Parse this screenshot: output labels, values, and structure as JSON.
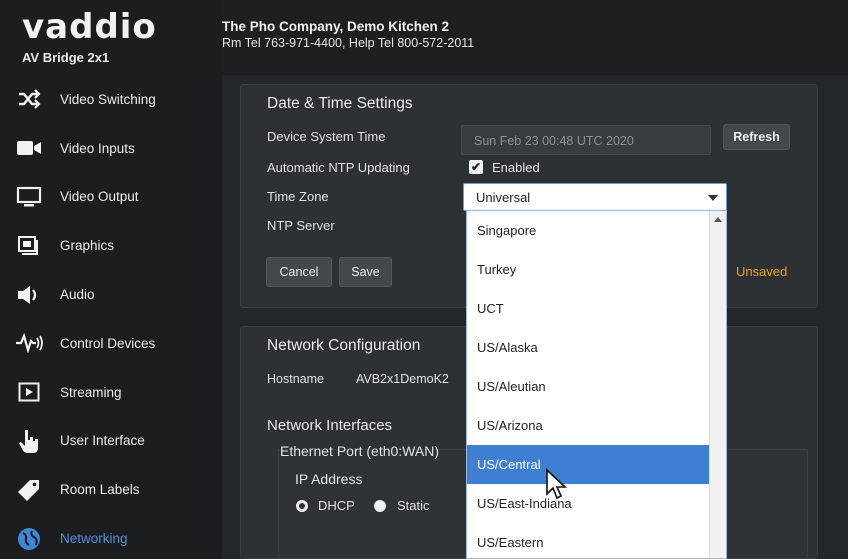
{
  "brand": {
    "logo": "vaddio",
    "product": "AV Bridge 2x1"
  },
  "header": {
    "company": "The Pho Company, Demo Kitchen 2",
    "contact": "Rm Tel 763-971-4400, Help Tel 800-572-2011"
  },
  "sidebar": {
    "items": [
      {
        "label": "Video Switching",
        "icon": "shuffle-icon"
      },
      {
        "label": "Video Inputs",
        "icon": "camera-icon"
      },
      {
        "label": "Video Output",
        "icon": "monitor-icon"
      },
      {
        "label": "Graphics",
        "icon": "graphics-icon"
      },
      {
        "label": "Audio",
        "icon": "speaker-icon"
      },
      {
        "label": "Control Devices",
        "icon": "control-devices-icon"
      },
      {
        "label": "Streaming",
        "icon": "play-icon"
      },
      {
        "label": "User Interface",
        "icon": "hand-pointer-icon"
      },
      {
        "label": "Room Labels",
        "icon": "tag-icon"
      },
      {
        "label": "Networking",
        "icon": "globe-icon",
        "active": true
      }
    ]
  },
  "datetime": {
    "title": "Date & Time Settings",
    "device_time_label": "Device System Time",
    "device_time_value": "Sun Feb 23 00:48 UTC 2020",
    "refresh_label": "Refresh",
    "ntp_label": "Automatic NTP Updating",
    "ntp_enabled_label": "Enabled",
    "ntp_checked": true,
    "timezone_label": "Time Zone",
    "timezone_value": "Universal",
    "ntp_server_label": "NTP Server",
    "cancel_label": "Cancel",
    "save_label": "Save",
    "unsaved_label": "Unsaved"
  },
  "timezone_dropdown": {
    "options": [
      "Singapore",
      "Turkey",
      "UCT",
      "US/Alaska",
      "US/Aleutian",
      "US/Arizona",
      "US/Central",
      "US/East-Indiana",
      "US/Eastern"
    ],
    "highlighted": "US/Central"
  },
  "network": {
    "title": "Network Configuration",
    "hostname_label": "Hostname",
    "hostname_value": "AVB2x1DemoK2",
    "interfaces_label": "Network Interfaces",
    "port_label": "Ethernet Port (eth0:WAN)",
    "ip_address_label": "IP Address",
    "dhcp_label": "DHCP",
    "static_label": "Static",
    "mode": "DHCP"
  },
  "colors": {
    "accent": "#3f7fd2",
    "unsaved": "#e3a415",
    "active_nav": "#4f8fd6"
  }
}
